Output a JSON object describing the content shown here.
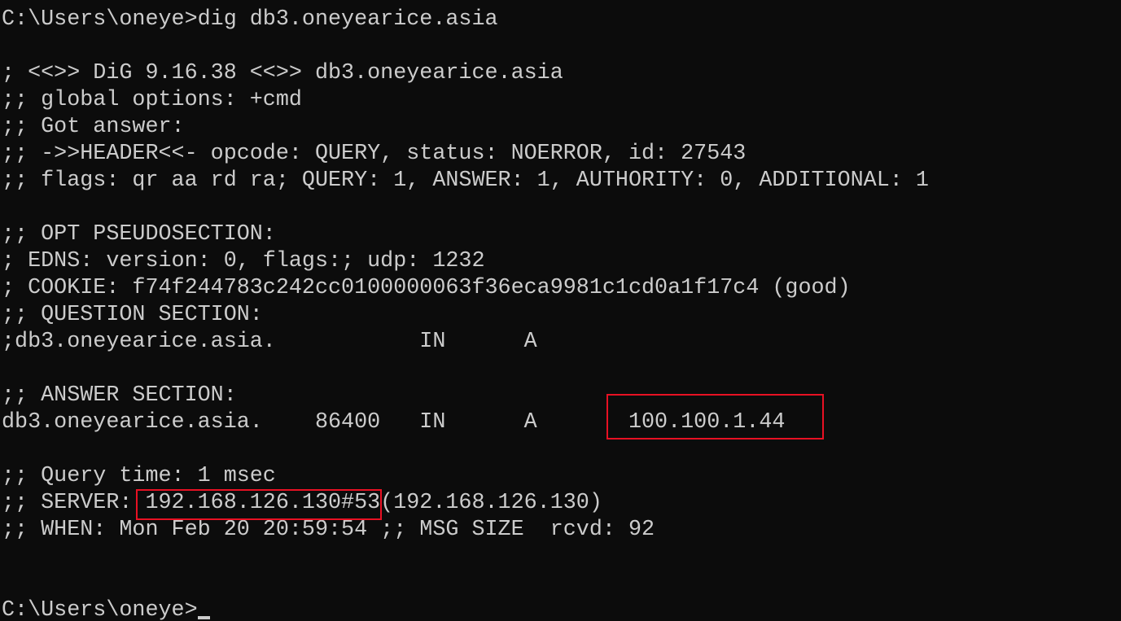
{
  "terminal": {
    "lines": [
      "C:\\Users\\oneye>dig db3.oneyearice.asia",
      "",
      "; <<>> DiG 9.16.38 <<>> db3.oneyearice.asia",
      ";; global options: +cmd",
      ";; Got answer:",
      ";; ->>HEADER<<- opcode: QUERY, status: NOERROR, id: 27543",
      ";; flags: qr aa rd ra; QUERY: 1, ANSWER: 1, AUTHORITY: 0, ADDITIONAL: 1",
      "",
      ";; OPT PSEUDOSECTION:",
      "; EDNS: version: 0, flags:; udp: 1232",
      "; COOKIE: f74f244783c242cc0100000063f36eca9981c1cd0a1f17c4 (good)",
      ";; QUESTION SECTION:",
      ";db3.oneyearice.asia.           IN      A",
      "",
      ";; ANSWER SECTION:",
      "db3.oneyearice.asia.    86400   IN      A       100.100.1.44",
      "",
      ";; Query time: 1 msec",
      ";; SERVER: 192.168.126.130#53(192.168.126.130)",
      ";; WHEN: Mon Feb 20 20:59:54 ;; MSG SIZE  rcvd: 92",
      "",
      "",
      "C:\\Users\\oneye>"
    ]
  },
  "colors": {
    "background": "#0c0c0c",
    "text": "#cccccc",
    "highlight_box": "#e81123"
  }
}
